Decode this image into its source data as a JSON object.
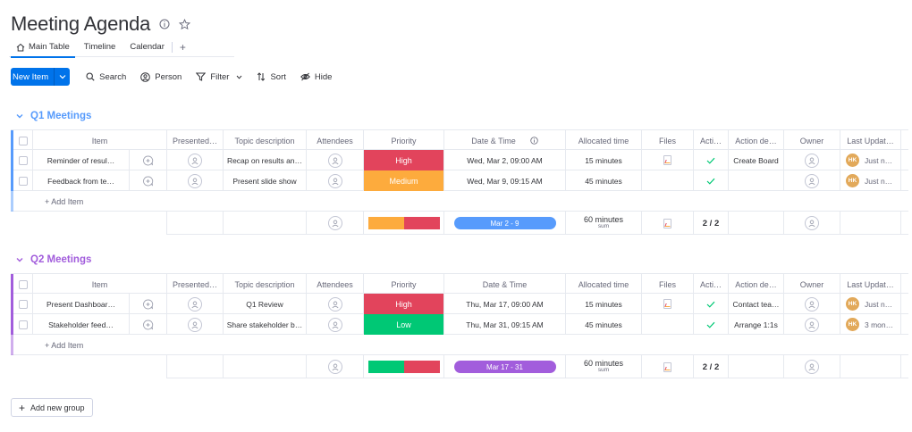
{
  "board": {
    "title": "Meeting Agenda"
  },
  "tabs": [
    {
      "label": "Main Table"
    },
    {
      "label": "Timeline"
    },
    {
      "label": "Calendar"
    }
  ],
  "toolbar": {
    "new_item_label": "New Item",
    "search_label": "Search",
    "person_label": "Person",
    "filter_label": "Filter",
    "sort_label": "Sort",
    "hide_label": "Hide"
  },
  "columns": {
    "item": "Item",
    "presenter": "Presented…",
    "topic": "Topic description",
    "attendees": "Attendees",
    "priority": "Priority",
    "datetime": "Date & Time",
    "allocated": "Allocated time",
    "files": "Files",
    "action": "Acti…",
    "action_desc": "Action de…",
    "owner": "Owner",
    "last_updated": "Last Updat…"
  },
  "colors": {
    "high": "#e2445c",
    "medium": "#fdab3d",
    "low": "#00c875",
    "group1": "#579bfc",
    "group2": "#a25ddc",
    "accent": "#0073ea"
  },
  "groups": [
    {
      "title": "Q1 Meetings",
      "add_item_label": "+ Add Item",
      "rows": [
        {
          "item": "Reminder of resul…",
          "topic": "Recap on results an…",
          "priority": "High",
          "datetime": "Wed, Mar 2, 09:00 AM",
          "allocated": "15 minutes",
          "action_desc": "Create Board",
          "owner_initials": "HK",
          "last_updated": "Just n…"
        },
        {
          "item": "Feedback from te…",
          "topic": "Present slide show",
          "priority": "Medium",
          "datetime": "Wed, Mar 9, 09:15 AM",
          "allocated": "45 minutes",
          "action_desc": "",
          "owner_initials": "HK",
          "last_updated": "Just n…"
        }
      ],
      "summary": {
        "timeline": "Mar 2 - 9",
        "allocated": "60 minutes",
        "allocated_sub": "sum",
        "action": "2 / 2",
        "priority_split": [
          {
            "status": "Medium",
            "fraction": 0.5
          },
          {
            "status": "High",
            "fraction": 0.5
          }
        ]
      }
    },
    {
      "title": "Q2 Meetings",
      "add_item_label": "+ Add Item",
      "rows": [
        {
          "item": "Present Dashboar…",
          "topic": "Q1 Review",
          "priority": "High",
          "datetime": "Thu, Mar 17, 09:00 AM",
          "allocated": "15 minutes",
          "action_desc": "Contact tea…",
          "owner_initials": "HK",
          "last_updated": "Just n…"
        },
        {
          "item": "Stakeholder feed…",
          "topic": "Share stakeholder b…",
          "priority": "Low",
          "datetime": "Thu, Mar 31, 09:15 AM",
          "allocated": "45 minutes",
          "action_desc": "Arrange 1:1s",
          "owner_initials": "HK",
          "last_updated": "3 mon…"
        }
      ],
      "summary": {
        "timeline": "Mar 17 - 31",
        "allocated": "60 minutes",
        "allocated_sub": "sum",
        "action": "2 / 2",
        "priority_split": [
          {
            "status": "Low",
            "fraction": 0.5
          },
          {
            "status": "High",
            "fraction": 0.5
          }
        ]
      }
    }
  ],
  "add_group_label": "Add new group"
}
